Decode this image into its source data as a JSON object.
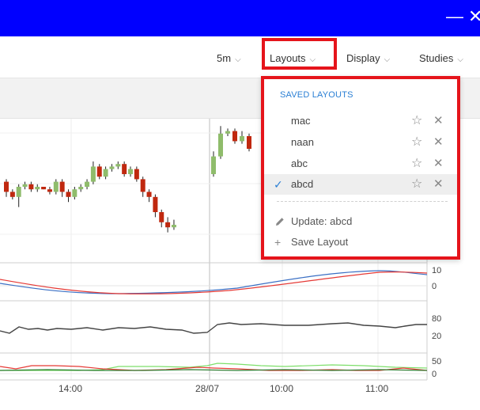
{
  "titlebar": {
    "minimize_glyph": "—",
    "close_glyph": "✕",
    "background": "#0000ff"
  },
  "toolbar": {
    "interval": "5m",
    "layouts": "Layouts",
    "display": "Display",
    "studies": "Studies",
    "chevron": "⌵",
    "highlight_color": "#e5141b"
  },
  "layouts_menu": {
    "header": "SAVED LAYOUTS",
    "items": [
      {
        "label": "mac",
        "selected": false
      },
      {
        "label": "naan",
        "selected": false
      },
      {
        "label": "abc",
        "selected": false
      },
      {
        "label": "abcd",
        "selected": true
      }
    ],
    "star_glyph": "☆",
    "remove_glyph": "✕",
    "check_glyph": "✓",
    "update_icon": "pencil-icon",
    "update_label": "Update: abcd",
    "save_icon": "plus-icon",
    "save_label": "Save Layout"
  },
  "chart": {
    "x_labels": [
      "14:00",
      "28/07",
      "10:00",
      "11:00"
    ],
    "panel1_labels": [
      "10",
      "0"
    ],
    "panel2_labels": [
      "80",
      "20"
    ],
    "panel3_labels": [
      "50",
      "0"
    ],
    "candles": [
      {
        "o": 72,
        "c": 68,
        "h": 73,
        "l": 66
      },
      {
        "o": 68,
        "c": 66,
        "h": 69,
        "l": 65
      },
      {
        "o": 66,
        "c": 70,
        "h": 71,
        "l": 62
      },
      {
        "o": 70,
        "c": 71,
        "h": 72,
        "l": 69
      },
      {
        "o": 71,
        "c": 69,
        "h": 72,
        "l": 68
      },
      {
        "o": 69,
        "c": 70,
        "h": 71,
        "l": 68
      },
      {
        "o": 70,
        "c": 69,
        "h": 70,
        "l": 69
      },
      {
        "o": 69,
        "c": 68,
        "h": 70,
        "l": 67
      },
      {
        "o": 68,
        "c": 72,
        "h": 73,
        "l": 67
      },
      {
        "o": 72,
        "c": 68,
        "h": 73,
        "l": 66
      },
      {
        "o": 68,
        "c": 66,
        "h": 69,
        "l": 64
      },
      {
        "o": 66,
        "c": 69,
        "h": 70,
        "l": 65
      },
      {
        "o": 69,
        "c": 70,
        "h": 71,
        "l": 68
      },
      {
        "o": 70,
        "c": 72,
        "h": 73,
        "l": 69
      },
      {
        "o": 72,
        "c": 78,
        "h": 80,
        "l": 71
      },
      {
        "o": 78,
        "c": 74,
        "h": 79,
        "l": 73
      },
      {
        "o": 74,
        "c": 77,
        "h": 78,
        "l": 73
      },
      {
        "o": 77,
        "c": 78,
        "h": 79,
        "l": 76
      },
      {
        "o": 78,
        "c": 79,
        "h": 80,
        "l": 77
      },
      {
        "o": 79,
        "c": 75,
        "h": 80,
        "l": 74
      },
      {
        "o": 75,
        "c": 77,
        "h": 78,
        "l": 74
      },
      {
        "o": 77,
        "c": 73,
        "h": 78,
        "l": 72
      },
      {
        "o": 73,
        "c": 68,
        "h": 74,
        "l": 66
      },
      {
        "o": 68,
        "c": 66,
        "h": 69,
        "l": 64
      },
      {
        "o": 66,
        "c": 60,
        "h": 67,
        "l": 58
      },
      {
        "o": 60,
        "c": 56,
        "h": 61,
        "l": 54
      },
      {
        "o": 56,
        "c": 54,
        "h": 58,
        "l": 52
      },
      {
        "o": 54,
        "c": 55,
        "h": 57,
        "l": 53
      },
      {
        "o": 75,
        "c": 82,
        "h": 84,
        "l": 74
      },
      {
        "o": 82,
        "c": 91,
        "h": 94,
        "l": 81
      },
      {
        "o": 91,
        "c": 92,
        "h": 93,
        "l": 90
      },
      {
        "o": 92,
        "c": 88,
        "h": 93,
        "l": 87
      },
      {
        "o": 88,
        "c": 90,
        "h": 92,
        "l": 87
      },
      {
        "o": 90,
        "c": 85,
        "h": 91,
        "l": 84
      }
    ],
    "colors": {
      "up": "#8fbc6b",
      "down": "#c0280f",
      "blue_line": "#3a6fc4",
      "red_line": "#e53935",
      "dark_line": "#444444",
      "green_line": "#4caf50"
    }
  }
}
